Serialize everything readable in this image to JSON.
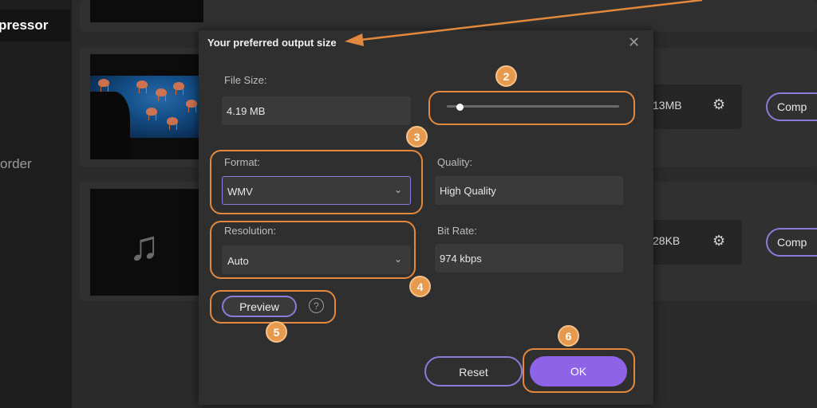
{
  "app": {
    "sidebar_title": "pressor",
    "sidebar_item": "order"
  },
  "rows": [
    {
      "size": "13MB",
      "compress_label": "Comp"
    },
    {
      "size": "28KB",
      "compress_label": "Comp"
    }
  ],
  "dialog": {
    "title": "Your preferred output size",
    "file_size_label": "File Size:",
    "file_size_value": "4.19 MB",
    "slider_level": 0.07,
    "format_label": "Format:",
    "format_value": "WMV",
    "quality_label": "Quality:",
    "quality_value": "High Quality",
    "resolution_label": "Resolution:",
    "resolution_value": "Auto",
    "bitrate_label": "Bit Rate:",
    "bitrate_value": "974 kbps",
    "preview_label": "Preview",
    "help_glyph": "?",
    "reset_label": "Reset",
    "ok_label": "OK"
  },
  "annotations": {
    "color": "#e2893e",
    "badges": [
      "2",
      "3",
      "4",
      "5",
      "6"
    ]
  },
  "colors": {
    "accent": "#8f63e8",
    "accent_border": "#8f79d9"
  }
}
